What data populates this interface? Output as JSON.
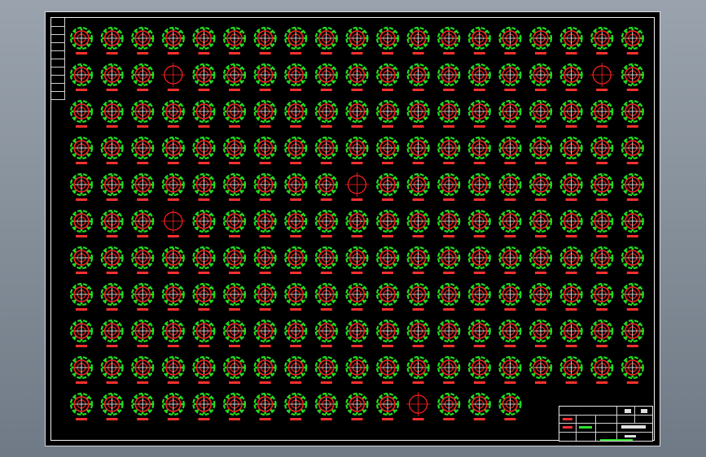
{
  "drawing": {
    "background": "#000000",
    "frame_color": "#ffffff",
    "symbol": {
      "name": "circular-flange-detail",
      "outer_ring_color": "#22dd22",
      "inner_ring_color": "#ff2020",
      "crosshair_color": "#ffffff",
      "label_color": "#ff3030"
    },
    "grid": {
      "rows": 11,
      "cols": 19,
      "last_row_count": 15,
      "simplified_cells": [
        [
          1,
          3
        ],
        [
          1,
          17
        ],
        [
          4,
          9
        ],
        [
          5,
          3
        ],
        [
          10,
          11
        ]
      ]
    }
  },
  "title_block": {
    "rows": 4,
    "rule_color": "#cfcfcf",
    "accent_red": "#ff3030",
    "accent_green": "#2fe02f"
  }
}
